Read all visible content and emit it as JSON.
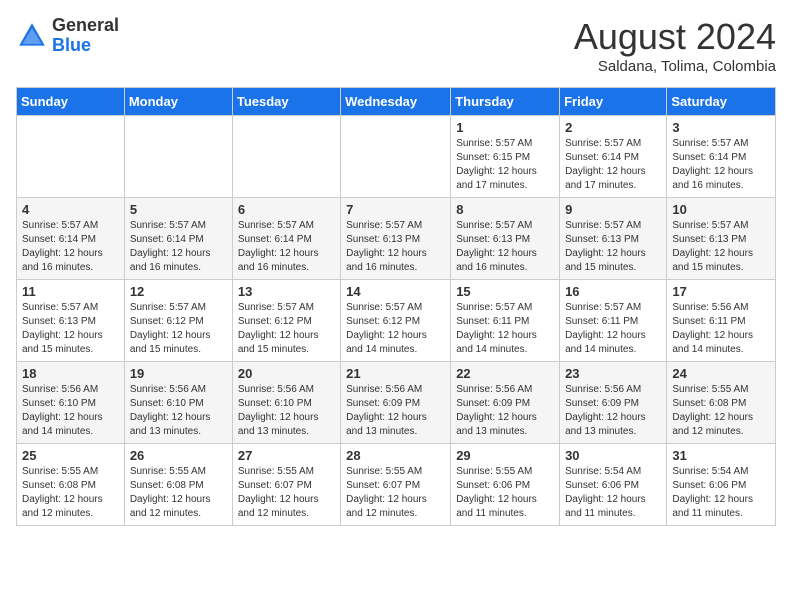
{
  "logo": {
    "general": "General",
    "blue": "Blue"
  },
  "header": {
    "month_year": "August 2024",
    "location": "Saldana, Tolima, Colombia"
  },
  "days_of_week": [
    "Sunday",
    "Monday",
    "Tuesday",
    "Wednesday",
    "Thursday",
    "Friday",
    "Saturday"
  ],
  "weeks": [
    [
      {
        "day": "",
        "info": ""
      },
      {
        "day": "",
        "info": ""
      },
      {
        "day": "",
        "info": ""
      },
      {
        "day": "",
        "info": ""
      },
      {
        "day": "1",
        "info": "Sunrise: 5:57 AM\nSunset: 6:15 PM\nDaylight: 12 hours\nand 17 minutes."
      },
      {
        "day": "2",
        "info": "Sunrise: 5:57 AM\nSunset: 6:14 PM\nDaylight: 12 hours\nand 17 minutes."
      },
      {
        "day": "3",
        "info": "Sunrise: 5:57 AM\nSunset: 6:14 PM\nDaylight: 12 hours\nand 16 minutes."
      }
    ],
    [
      {
        "day": "4",
        "info": "Sunrise: 5:57 AM\nSunset: 6:14 PM\nDaylight: 12 hours\nand 16 minutes."
      },
      {
        "day": "5",
        "info": "Sunrise: 5:57 AM\nSunset: 6:14 PM\nDaylight: 12 hours\nand 16 minutes."
      },
      {
        "day": "6",
        "info": "Sunrise: 5:57 AM\nSunset: 6:14 PM\nDaylight: 12 hours\nand 16 minutes."
      },
      {
        "day": "7",
        "info": "Sunrise: 5:57 AM\nSunset: 6:13 PM\nDaylight: 12 hours\nand 16 minutes."
      },
      {
        "day": "8",
        "info": "Sunrise: 5:57 AM\nSunset: 6:13 PM\nDaylight: 12 hours\nand 16 minutes."
      },
      {
        "day": "9",
        "info": "Sunrise: 5:57 AM\nSunset: 6:13 PM\nDaylight: 12 hours\nand 15 minutes."
      },
      {
        "day": "10",
        "info": "Sunrise: 5:57 AM\nSunset: 6:13 PM\nDaylight: 12 hours\nand 15 minutes."
      }
    ],
    [
      {
        "day": "11",
        "info": "Sunrise: 5:57 AM\nSunset: 6:13 PM\nDaylight: 12 hours\nand 15 minutes."
      },
      {
        "day": "12",
        "info": "Sunrise: 5:57 AM\nSunset: 6:12 PM\nDaylight: 12 hours\nand 15 minutes."
      },
      {
        "day": "13",
        "info": "Sunrise: 5:57 AM\nSunset: 6:12 PM\nDaylight: 12 hours\nand 15 minutes."
      },
      {
        "day": "14",
        "info": "Sunrise: 5:57 AM\nSunset: 6:12 PM\nDaylight: 12 hours\nand 14 minutes."
      },
      {
        "day": "15",
        "info": "Sunrise: 5:57 AM\nSunset: 6:11 PM\nDaylight: 12 hours\nand 14 minutes."
      },
      {
        "day": "16",
        "info": "Sunrise: 5:57 AM\nSunset: 6:11 PM\nDaylight: 12 hours\nand 14 minutes."
      },
      {
        "day": "17",
        "info": "Sunrise: 5:56 AM\nSunset: 6:11 PM\nDaylight: 12 hours\nand 14 minutes."
      }
    ],
    [
      {
        "day": "18",
        "info": "Sunrise: 5:56 AM\nSunset: 6:10 PM\nDaylight: 12 hours\nand 14 minutes."
      },
      {
        "day": "19",
        "info": "Sunrise: 5:56 AM\nSunset: 6:10 PM\nDaylight: 12 hours\nand 13 minutes."
      },
      {
        "day": "20",
        "info": "Sunrise: 5:56 AM\nSunset: 6:10 PM\nDaylight: 12 hours\nand 13 minutes."
      },
      {
        "day": "21",
        "info": "Sunrise: 5:56 AM\nSunset: 6:09 PM\nDaylight: 12 hours\nand 13 minutes."
      },
      {
        "day": "22",
        "info": "Sunrise: 5:56 AM\nSunset: 6:09 PM\nDaylight: 12 hours\nand 13 minutes."
      },
      {
        "day": "23",
        "info": "Sunrise: 5:56 AM\nSunset: 6:09 PM\nDaylight: 12 hours\nand 13 minutes."
      },
      {
        "day": "24",
        "info": "Sunrise: 5:55 AM\nSunset: 6:08 PM\nDaylight: 12 hours\nand 12 minutes."
      }
    ],
    [
      {
        "day": "25",
        "info": "Sunrise: 5:55 AM\nSunset: 6:08 PM\nDaylight: 12 hours\nand 12 minutes."
      },
      {
        "day": "26",
        "info": "Sunrise: 5:55 AM\nSunset: 6:08 PM\nDaylight: 12 hours\nand 12 minutes."
      },
      {
        "day": "27",
        "info": "Sunrise: 5:55 AM\nSunset: 6:07 PM\nDaylight: 12 hours\nand 12 minutes."
      },
      {
        "day": "28",
        "info": "Sunrise: 5:55 AM\nSunset: 6:07 PM\nDaylight: 12 hours\nand 12 minutes."
      },
      {
        "day": "29",
        "info": "Sunrise: 5:55 AM\nSunset: 6:06 PM\nDaylight: 12 hours\nand 11 minutes."
      },
      {
        "day": "30",
        "info": "Sunrise: 5:54 AM\nSunset: 6:06 PM\nDaylight: 12 hours\nand 11 minutes."
      },
      {
        "day": "31",
        "info": "Sunrise: 5:54 AM\nSunset: 6:06 PM\nDaylight: 12 hours\nand 11 minutes."
      }
    ]
  ]
}
